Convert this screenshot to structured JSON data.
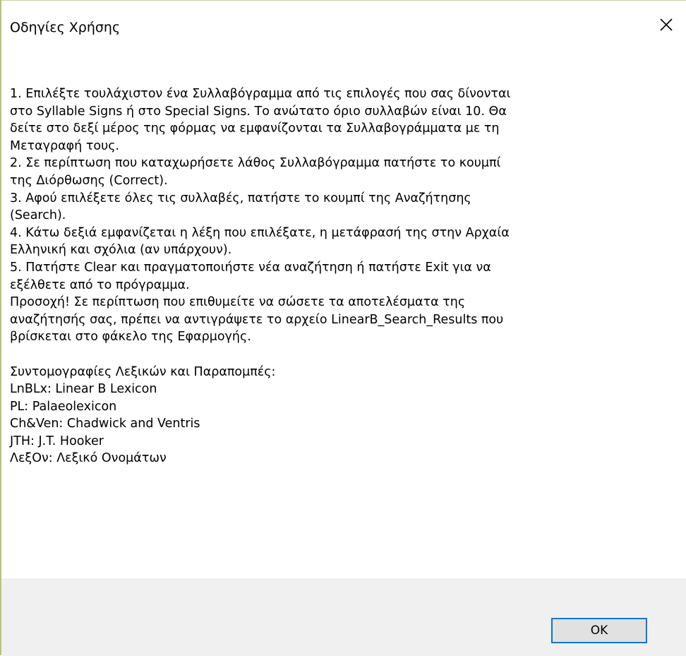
{
  "window": {
    "title": "Οδηγίες Χρήσης",
    "close_icon": "close-icon"
  },
  "instructions": {
    "lines": [
      "1. Επιλέξτε τουλάχιστον ένα Συλλαβόγραμμα από τις επιλογές που σας δίνονται",
      "στο Syllable Signs ή στο Special Signs. Το ανώτατο όριο συλλαβών είναι 10. Θα",
      "δείτε στο δεξί μέρος της φόρμας να εμφανίζονται τα Συλλαβογράμματα με τη",
      "Μεταγραφή τους.",
      "2. Σε περίπτωση που καταχωρήσετε λάθος Συλλαβόγραμμα πατήστε το κουμπί",
      "της Διόρθωσης (Correct).",
      "3. Αφού επιλέξετε όλες τις συλλαβές, πατήστε το κουμπί της Αναζήτησης",
      "(Search).",
      "4. Κάτω δεξιά εμφανίζεται η λέξη που επιλέξατε, η μετάφρασή της στην Αρχαία",
      "Ελληνική και σχόλια (αν υπάρχουν).",
      "5. Πατήστε Clear και πραγματοποιήστε νέα αναζήτηση ή πατήστε Exit για να",
      "εξέλθετε από το πρόγραμμα.",
      "Προσοχή! Σε περίπτωση που επιθυμείτε να σώσετε τα αποτελέσματα της",
      "αναζήτησής σας, πρέπει να αντιγράψετε το αρχείο LinearB_Search_Results που",
      "βρίσκεται στο φάκελο της Εφαρμογής."
    ]
  },
  "abbreviations": {
    "heading": "Συντομογραφίες Λεξικών και Παραπομπές:",
    "items": [
      "LnBLx: Linear B Lexicon",
      "PL: Palaeolexicon",
      "Ch&Ven: Chadwick and Ventris",
      "JTH: J.T. Hooker",
      "ΛεξΟν: Λεξικό Ονομάτων"
    ]
  },
  "footer": {
    "ok_label": "OK",
    "accent_color": "#0078d7",
    "background_color": "#f0f0f0"
  }
}
